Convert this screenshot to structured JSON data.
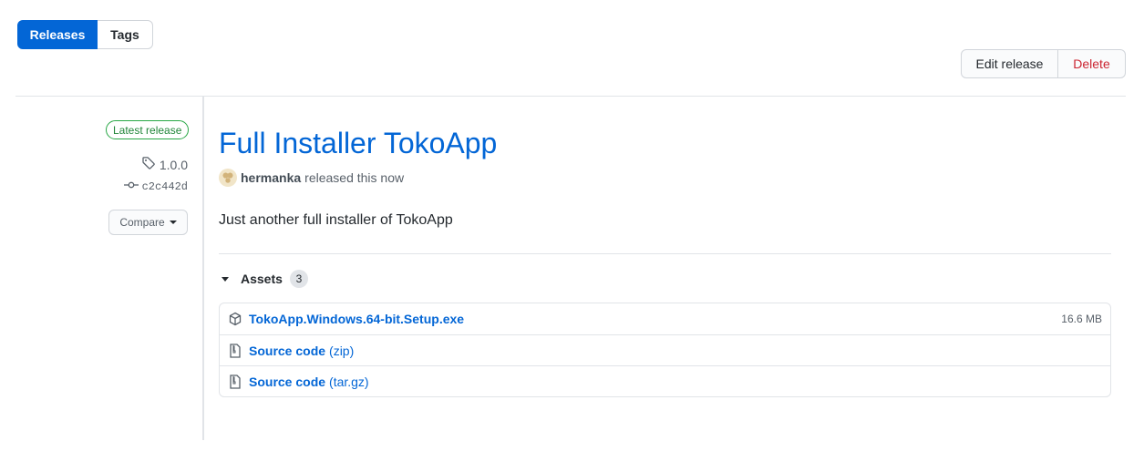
{
  "tabs": {
    "releases": "Releases",
    "tags": "Tags"
  },
  "actions": {
    "edit": "Edit release",
    "delete": "Delete"
  },
  "sidebar": {
    "latest_badge": "Latest release",
    "tag": "1.0.0",
    "commit": "c2c442d",
    "compare": "Compare"
  },
  "release": {
    "title": "Full Installer TokoApp",
    "author": "hermanka",
    "released_text": "released this now",
    "description": "Just another full installer of TokoApp"
  },
  "assets": {
    "label": "Assets",
    "count": "3",
    "items": [
      {
        "name": "TokoApp.Windows.64-bit.Setup.exe",
        "sub": "",
        "size": "16.6 MB",
        "icon": "package-icon"
      },
      {
        "name": "Source code",
        "sub": "(zip)",
        "size": "",
        "icon": "file-zip-icon"
      },
      {
        "name": "Source code",
        "sub": "(tar.gz)",
        "size": "",
        "icon": "file-zip-icon"
      }
    ]
  },
  "colors": {
    "accent": "#0366d6",
    "danger": "#cb2431",
    "success": "#28a745"
  }
}
